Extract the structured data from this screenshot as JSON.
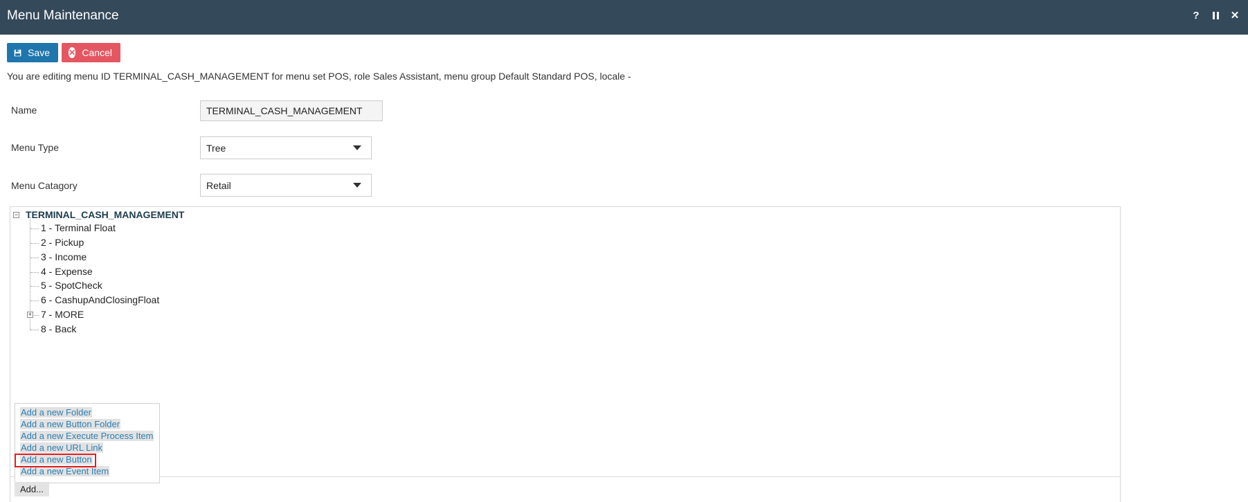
{
  "window": {
    "title": "Menu Maintenance",
    "help_icon": "question-icon",
    "pause_icon": "pause-icon",
    "close_icon": "close-icon"
  },
  "toolbar": {
    "save_label": "Save",
    "cancel_label": "Cancel",
    "save_color": "#1f76ad",
    "cancel_color": "#e45762"
  },
  "info_text": "You are editing menu ID TERMINAL_CASH_MANAGEMENT for menu set POS, role Sales Assistant, menu group Default Standard POS, locale -",
  "form": {
    "name_label": "Name",
    "name_value": "TERMINAL_CASH_MANAGEMENT",
    "menu_type_label": "Menu Type",
    "menu_type_value": "Tree",
    "menu_category_label": "Menu Catagory",
    "menu_category_value": "Retail"
  },
  "tree": {
    "root": "TERMINAL_CASH_MANAGEMENT",
    "items": [
      "1 - Terminal Float",
      "2 - Pickup",
      "3 - Income",
      "4 - Expense",
      "5 - SpotCheck",
      "6 - CashupAndClosingFloat",
      "7 - MORE",
      "8 - Back"
    ]
  },
  "add_menu": {
    "items": [
      "Add a new Folder",
      "Add a new Button Folder",
      "Add a new Execute Process Item",
      "Add a new URL Link",
      "Add a new Button",
      "Add a new Event Item"
    ],
    "highlighted_item": "Add a new Button",
    "highlight_color": "#e81a1a",
    "add_button_label": "Add..."
  }
}
